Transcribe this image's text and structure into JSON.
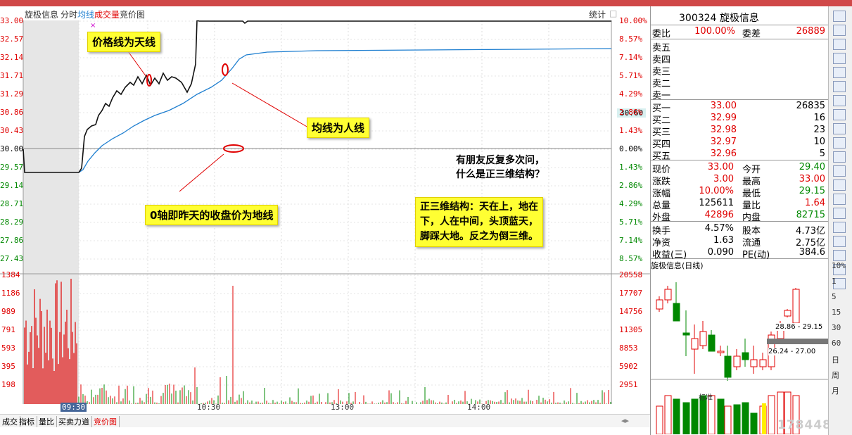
{
  "tabs": {
    "stock": "旋极信息",
    "items": [
      "分时",
      "均线",
      "成交量",
      "竞价图"
    ],
    "stats": "统计"
  },
  "price_axis": {
    "left": [
      "33.00",
      "32.57",
      "32.14",
      "31.71",
      "31.29",
      "30.86",
      "30.43",
      "30.00",
      "29.57",
      "29.14",
      "28.71",
      "28.29",
      "27.86",
      "27.43"
    ],
    "right": [
      "10.00%",
      "8.57%",
      "7.14%",
      "5.71%",
      "4.29%",
      "2.86%",
      "1.43%",
      "0.00%",
      "1.43%",
      "2.86%",
      "4.29%",
      "5.71%",
      "7.14%",
      "8.57%"
    ],
    "current_tag": "30.60"
  },
  "volume_axis": {
    "left": [
      "1384",
      "1186",
      "989",
      "791",
      "593",
      "395",
      "198"
    ],
    "right": [
      "20558",
      "17707",
      "14756",
      "11305",
      "8853",
      "5902",
      "2951"
    ]
  },
  "time_axis": [
    "09:30",
    "10:30",
    "13:00",
    "14:00"
  ],
  "annotations": {
    "sky": "价格线为天线",
    "person": "均线为人线",
    "ground": "0轴即昨天的收盘价为地线",
    "question": "有朋友反复多次问，\n什么是正三维结构？",
    "definition": "正三维结构：天在上，地在\n下，人在中间，头顶蓝天，\n脚踩大地。反之为倒三维。"
  },
  "bottom_tabs": [
    "成交",
    "指标",
    "量比",
    "买卖力道",
    "竞价图"
  ],
  "quote": {
    "code": "300324",
    "name": "旋极信息",
    "weibi_label": "委比",
    "weibi": "100.00%",
    "weicha_label": "委差",
    "weicha": "26889",
    "sell_labels": [
      "卖五",
      "卖四",
      "卖三",
      "卖二",
      "卖一"
    ],
    "buy": [
      {
        "label": "买一",
        "price": "33.00",
        "vol": "26835"
      },
      {
        "label": "买二",
        "price": "32.99",
        "vol": "16"
      },
      {
        "label": "买三",
        "price": "32.98",
        "vol": "23"
      },
      {
        "label": "买四",
        "price": "32.97",
        "vol": "10"
      },
      {
        "label": "买五",
        "price": "32.96",
        "vol": "5"
      }
    ],
    "stats": [
      {
        "l": "现价",
        "lv": "33.00",
        "m": "今开",
        "mv": "29.40"
      },
      {
        "l": "涨跌",
        "lv": "3.00",
        "m": "最高",
        "mv": "33.00"
      },
      {
        "l": "涨幅",
        "lv": "10.00%",
        "m": "最低",
        "mv": "29.15"
      },
      {
        "l": "总量",
        "lv": "125611",
        "m": "量比",
        "mv": "1.64"
      },
      {
        "l": "外盘",
        "lv": "42896",
        "m": "内盘",
        "mv": "82715"
      }
    ],
    "stats2": [
      {
        "l": "换手",
        "lv": "4.57%",
        "m": "股本",
        "mv": "4.73亿"
      },
      {
        "l": "净资",
        "lv": "1.63",
        "m": "流通",
        "mv": "2.75亿"
      },
      {
        "l": "收益(三)",
        "lv": "0.090",
        "m": "PE(动)",
        "mv": "384.6"
      }
    ],
    "daily_label": "旋极信息(日线)",
    "range1": "28.86 - 29.15",
    "range2": "26.24 - 27.00",
    "mini_label": "标准"
  },
  "toolbar_numbers": [
    "10%",
    "1",
    "5",
    "15",
    "30",
    "60",
    "日",
    "周",
    "月"
  ],
  "watermark": "178448.com",
  "colors": {
    "up": "#e00000",
    "down": "#008800",
    "avg": "#1f7fd0",
    "price": "#000000"
  }
}
